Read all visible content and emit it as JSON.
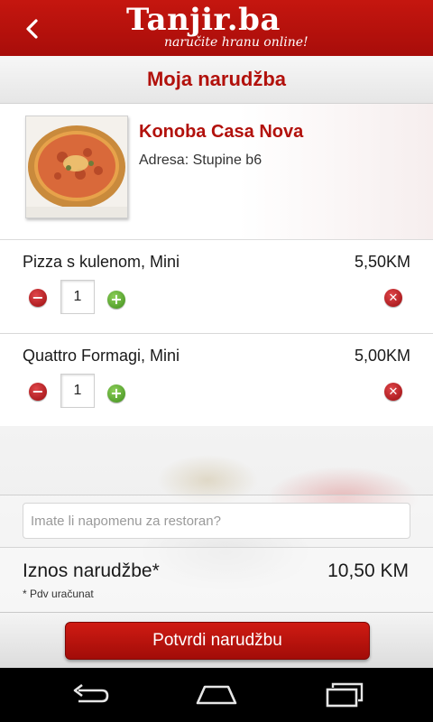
{
  "header": {
    "brand_name": "Tanjir.ba",
    "tagline": "naručite hranu online!",
    "back_icon": "chevron-left-icon"
  },
  "page": {
    "title": "Moja narudžba"
  },
  "restaurant": {
    "name": "Konoba Casa Nova",
    "address": "Adresa: Stupine b6",
    "image": "pizza-thumbnail"
  },
  "items": [
    {
      "name": "Pizza s kulenom, Mini",
      "price": "5,50KM",
      "quantity": "1"
    },
    {
      "name": "Quattro Formagi, Mini",
      "price": "5,00KM",
      "quantity": "1"
    }
  ],
  "note": {
    "placeholder": "Imate li napomenu za restoran?"
  },
  "total": {
    "label": "Iznos narudžbe*",
    "value": "10,50 KM",
    "vat_note": "* Pdv uračunat"
  },
  "confirm": {
    "label": "Potvrdi narudžbu"
  },
  "colors": {
    "brand_red": "#b2110c",
    "minus_red": "#c0181c",
    "plus_green": "#5aaa2c"
  },
  "system_nav": [
    "back-icon",
    "home-icon",
    "recents-icon"
  ]
}
